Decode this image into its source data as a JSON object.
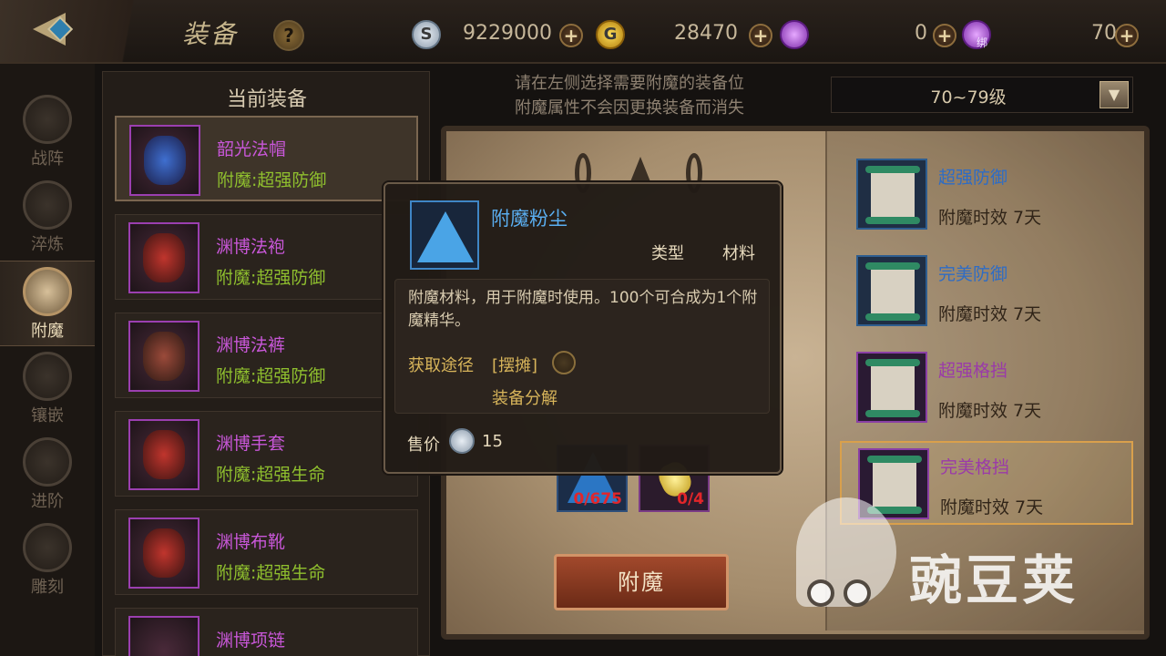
{
  "header": {
    "title": "装备",
    "help_label": "?",
    "currencies": [
      {
        "icon": "silver-coin-icon",
        "value": "9229000"
      },
      {
        "icon": "gold-coin-icon",
        "value": "28470"
      },
      {
        "icon": "purple-crystal-icon",
        "value": "0"
      },
      {
        "icon": "bound-purple-crystal-icon",
        "value": "70",
        "tag": "绑"
      }
    ],
    "plus_label": "+"
  },
  "sidenav": {
    "items": [
      {
        "label": "战阵",
        "active": false
      },
      {
        "label": "淬炼",
        "active": false
      },
      {
        "label": "附魔",
        "active": true
      },
      {
        "label": "镶嵌",
        "active": false
      },
      {
        "label": "进阶",
        "active": false
      },
      {
        "label": "雕刻",
        "active": false
      }
    ]
  },
  "equipment": {
    "header": "当前装备",
    "items": [
      {
        "name": "韶光法帽",
        "enchant": "附魔:超强防御"
      },
      {
        "name": "渊博法袍",
        "enchant": "附魔:超强防御"
      },
      {
        "name": "渊博法裤",
        "enchant": "附魔:超强防御"
      },
      {
        "name": "渊博手套",
        "enchant": "附魔:超强生命"
      },
      {
        "name": "渊博布靴",
        "enchant": "附魔:超强生命"
      },
      {
        "name": "渊博项链",
        "enchant": ""
      }
    ]
  },
  "main": {
    "hint_line1": "请在左侧选择需要附魔的装备位",
    "hint_line2": "附魔属性不会因更换装备而消失",
    "level_select": "70~79级",
    "materials": [
      {
        "name": "附魔粉尘",
        "count": "0/675"
      },
      {
        "name": "gem",
        "count": "0/4"
      }
    ],
    "enchant_button": "附魔"
  },
  "scrolls": [
    {
      "name": "超强防御",
      "duration": "附魔时效 7天",
      "rarity": "blue"
    },
    {
      "name": "完美防御",
      "duration": "附魔时效 7天",
      "rarity": "blue"
    },
    {
      "name": "超强格挡",
      "duration": "附魔时效 7天",
      "rarity": "purple"
    },
    {
      "name": "完美格挡",
      "duration": "附魔时效 7天",
      "rarity": "purple"
    }
  ],
  "tooltip": {
    "name": "附魔粉尘",
    "type_label": "类型",
    "type_value": "材料",
    "description": "附魔材料，用于附魔时使用。100个可合成为1个附魔精华。",
    "source_label": "获取途径",
    "source_1": "[摆摊]",
    "source_2": "装备分解",
    "price_label": "售价",
    "price_value": "15"
  },
  "watermark": {
    "text": "豌豆荚"
  }
}
